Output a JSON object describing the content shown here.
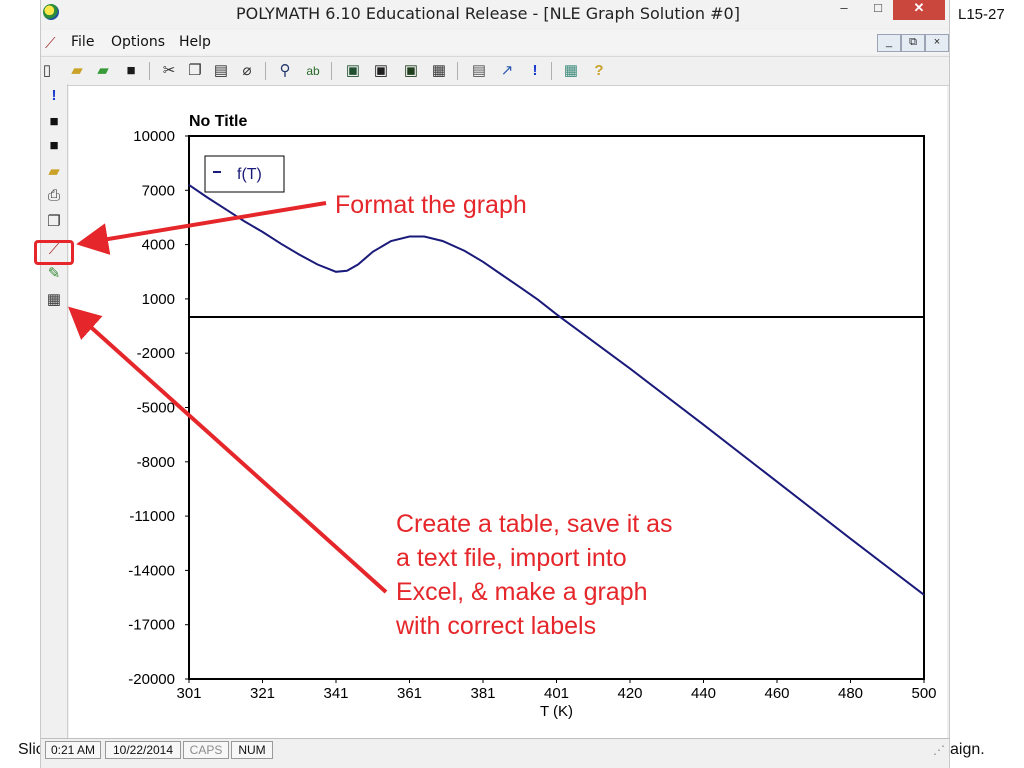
{
  "window": {
    "title": "POLYMATH 6.10 Educational Release - [NLE Graph Solution #0]",
    "controls": {
      "minimize": "–",
      "maximize": "□",
      "close": "✕"
    }
  },
  "menubar": {
    "items": [
      "File",
      "Options",
      "Help"
    ],
    "mdi_controls": {
      "minimize": "_",
      "restore": "⧉",
      "close": "×"
    }
  },
  "toolbar": {
    "icons": [
      "new-file-icon",
      "open-folder-icon",
      "open-folder-alt-icon",
      "save-icon",
      "cut-icon",
      "copy-icon",
      "paste-icon",
      "eraser-icon",
      "find-icon",
      "replace-icon",
      "graph-icon",
      "function-icon",
      "derivative-icon",
      "table-icon",
      "calculator-icon",
      "wand-icon",
      "exclamation-icon",
      "spreadsheet-icon",
      "help-icon"
    ]
  },
  "sidebar": {
    "icons": [
      "exclamation-icon",
      "save-icon",
      "save-as-icon",
      "open-folder-icon",
      "print-icon",
      "copy-icon",
      "format-graph-icon",
      "edit-icon",
      "table-icon"
    ]
  },
  "slide": {
    "number": "L15-27",
    "footer_left": "Slic",
    "footer_right": "aign."
  },
  "status_bar": {
    "time": "0:21 AM",
    "date": "10/22/2014",
    "caps": "CAPS",
    "num": "NUM"
  },
  "chart_data": {
    "type": "line",
    "title": "No Title",
    "xlabel": "T (K)",
    "ylabel": "",
    "xlim": [
      301,
      500
    ],
    "ylim": [
      -20000,
      10000
    ],
    "x_ticks": [
      "301",
      "321",
      "341",
      "361",
      "381",
      "401",
      "420",
      "440",
      "460",
      "480",
      "500"
    ],
    "y_ticks": [
      "10000",
      "7000",
      "4000",
      "1000",
      "-2000",
      "-5000",
      "-8000",
      "-11000",
      "-14000",
      "-17000",
      "-20000"
    ],
    "legend": "top-left",
    "grid": false,
    "series": [
      {
        "name": "f(T)",
        "color": "#1a1a7a",
        "x": [
          301,
          306,
          311,
          316,
          321,
          326,
          331,
          336,
          341,
          344,
          347,
          351,
          356,
          361,
          365,
          370,
          376,
          381,
          386,
          391,
          396,
          401,
          420,
          440,
          460,
          480,
          500
        ],
        "y": [
          7300,
          6600,
          5950,
          5300,
          4700,
          4050,
          3450,
          2900,
          2500,
          2550,
          2900,
          3600,
          4200,
          4450,
          4450,
          4200,
          3650,
          3050,
          2350,
          1650,
          950,
          150,
          -2850,
          -5950,
          -9100,
          -12250,
          -15350
        ]
      }
    ],
    "reference_line_y": 0
  },
  "annotations": {
    "format_graph": "Format the graph",
    "create_table": [
      "Create a table, save it as",
      "a text file, import into",
      "Excel, & make a graph",
      "with correct labels"
    ]
  }
}
